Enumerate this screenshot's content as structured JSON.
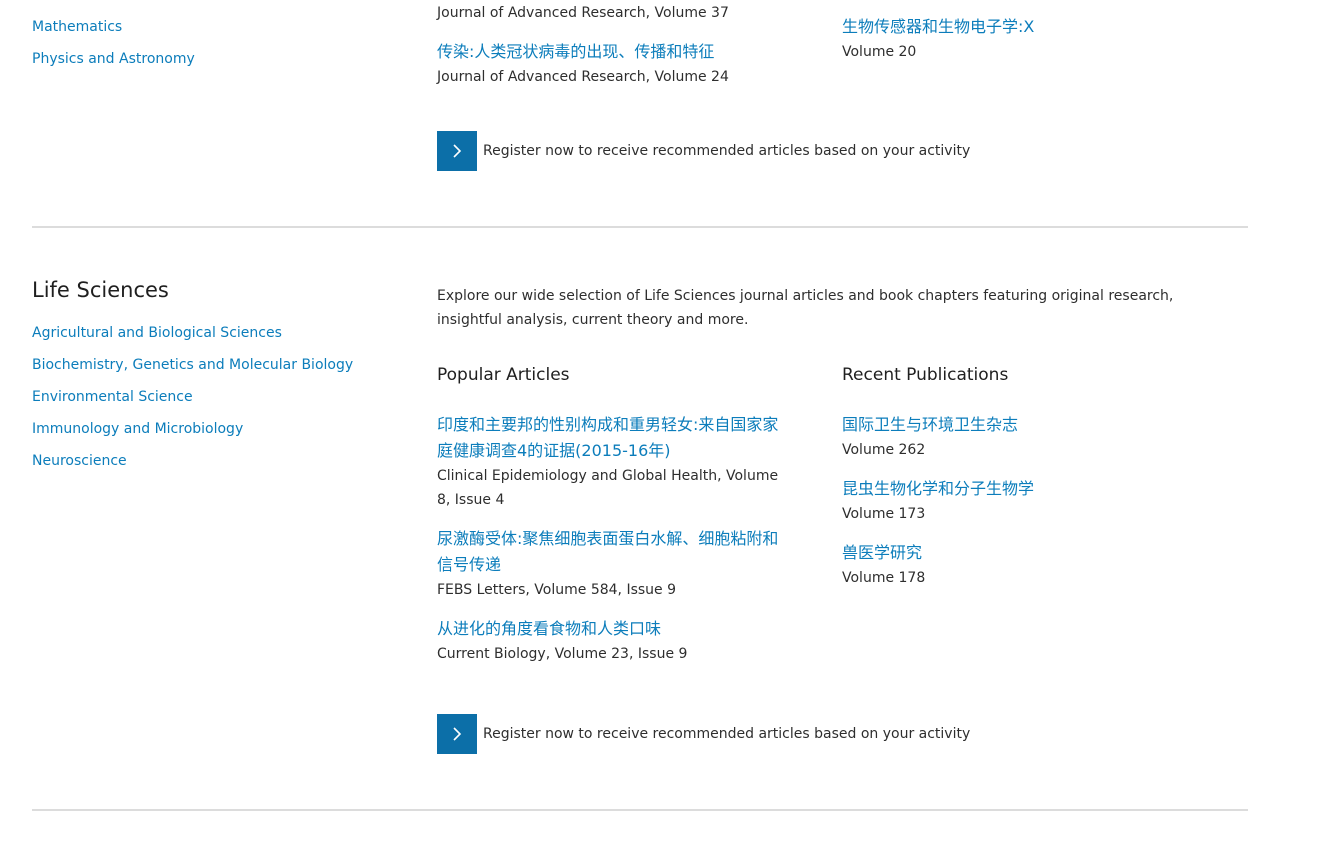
{
  "top": {
    "left_links": [
      "Mathematics",
      "Physics and Astronomy"
    ],
    "popular": {
      "first_meta": "Journal of Advanced Research, Volume 37",
      "items": [
        {
          "title": "传染:人类冠状病毒的出现、传播和特征",
          "meta": "Journal of Advanced Research, Volume 24"
        }
      ]
    },
    "recent": {
      "items": [
        {
          "title": "生物传感器和生物电子学:X",
          "meta": "Volume 20"
        }
      ]
    },
    "register_text": "Register now to receive recommended articles based on your activity"
  },
  "life_sciences": {
    "title": "Life Sciences",
    "subjects": [
      "Agricultural and Biological Sciences",
      "Biochemistry, Genetics and Molecular Biology",
      "Environmental Science",
      "Immunology and Microbiology",
      "Neuroscience"
    ],
    "description": "Explore our wide selection of Life Sciences journal articles and book chapters featuring original research, insightful analysis, current theory and more.",
    "popular_heading": "Popular Articles",
    "popular": [
      {
        "title": "印度和主要邦的性别构成和重男轻女:来自国家家庭健康调查4的证据(2015-16年)",
        "meta": "Clinical Epidemiology and Global Health, Volume 8, Issue 4"
      },
      {
        "title": "尿激酶受体:聚焦细胞表面蛋白水解、细胞粘附和信号传递",
        "meta": "FEBS Letters, Volume 584, Issue 9"
      },
      {
        "title": "从进化的角度看食物和人类口味",
        "meta": "Current Biology, Volume 23, Issue 9"
      }
    ],
    "recent_heading": "Recent Publications",
    "recent": [
      {
        "title": "国际卫生与环境卫生杂志",
        "meta": "Volume 262"
      },
      {
        "title": "昆虫生物化学和分子生物学",
        "meta": "Volume 173"
      },
      {
        "title": "兽医学研究",
        "meta": "Volume 178"
      }
    ],
    "register_text": "Register now to receive recommended articles based on your activity"
  },
  "icons": {
    "register": "chevron-right-icon"
  },
  "colors": {
    "link": "#0c7dbb",
    "button": "#0c6fa8",
    "divider": "#dcdcdc"
  }
}
